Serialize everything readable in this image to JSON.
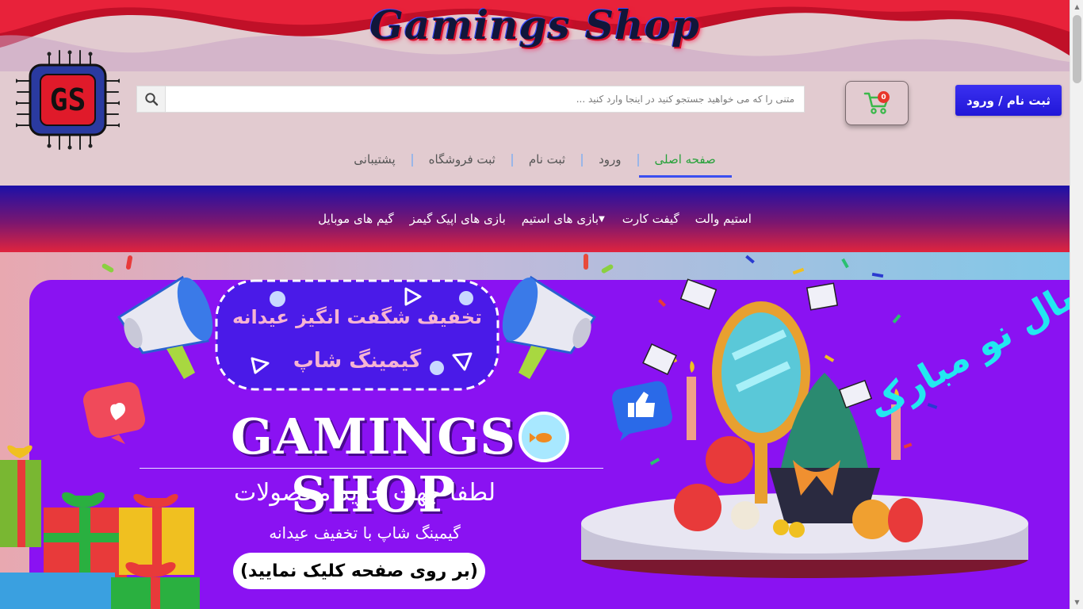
{
  "header": {
    "site_title": "Gamings Shop",
    "logo_text": "GS",
    "signup_login_label": "ثبت نام / ورود",
    "cart_count": "0",
    "search": {
      "placeholder": "متنی را که می خواهید جستجو کنید در اینجا وارد کنید ...",
      "value": ""
    }
  },
  "main_nav": {
    "items": [
      {
        "label": "صفحه اصلی",
        "active": true
      },
      {
        "label": "ورود",
        "active": false
      },
      {
        "label": "ثبت نام",
        "active": false
      },
      {
        "label": "ثبت فروشگاه",
        "active": false
      },
      {
        "label": "پشتیبانی",
        "active": false
      }
    ]
  },
  "category_nav": {
    "items": [
      {
        "label": "استیم والت"
      },
      {
        "label": "گیفت کارت"
      },
      {
        "label": "بازی های استیم",
        "has_dropdown": true
      },
      {
        "label": "بازی های اپیک گیمز"
      },
      {
        "label": "گیم های موبایل"
      }
    ]
  },
  "banner": {
    "promo_line1": "تخفیف شگفت انگیز عیدانه",
    "promo_line2": "گیمینگ شاپ",
    "brand": "GAMINGS SHOP",
    "line1": "لطفا جهت خرید محصولات",
    "line2": "گیمینگ شاپ با تخفیف عیدانه",
    "cta": "(بر روی صفحه کلیک نمایید)",
    "calligraphy": "سال نو مبارک"
  },
  "colors": {
    "header_bg": "#e2cbd0",
    "accent_blue": "#2a20e0",
    "active_green": "#27a13a",
    "banner_purple": "#8a12f2"
  }
}
